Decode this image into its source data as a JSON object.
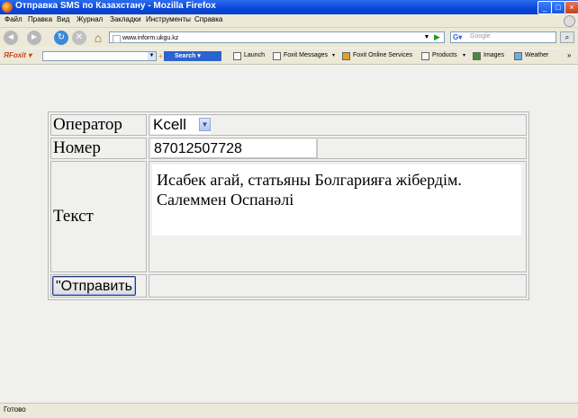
{
  "window": {
    "title": "Отправка SMS по Казахстану - Mozilla Firefox"
  },
  "menu": [
    "Файл",
    "Правка",
    "Вид",
    "Журнал",
    "Закладки",
    "Инструменты",
    "Справка"
  ],
  "nav": {
    "url": "www.inform.ukgu.kz",
    "search_placeholder": "Google"
  },
  "foxit": {
    "search_label": "Search",
    "items": [
      "Launch",
      "Foxit Messages",
      "Foxit Online Services",
      "Products",
      "Images",
      "Weather"
    ]
  },
  "form": {
    "operator_label": "Оператор",
    "operator_value": "Kcell",
    "number_label": "Номер",
    "number_value": "87012507728",
    "text_label": "Текст",
    "text_value": "Исабек агай, статьяны Болгарияға жібердім. Салеммен Оспанәлі",
    "send_label": "\"Отправить"
  },
  "status": {
    "text": "Готово"
  }
}
